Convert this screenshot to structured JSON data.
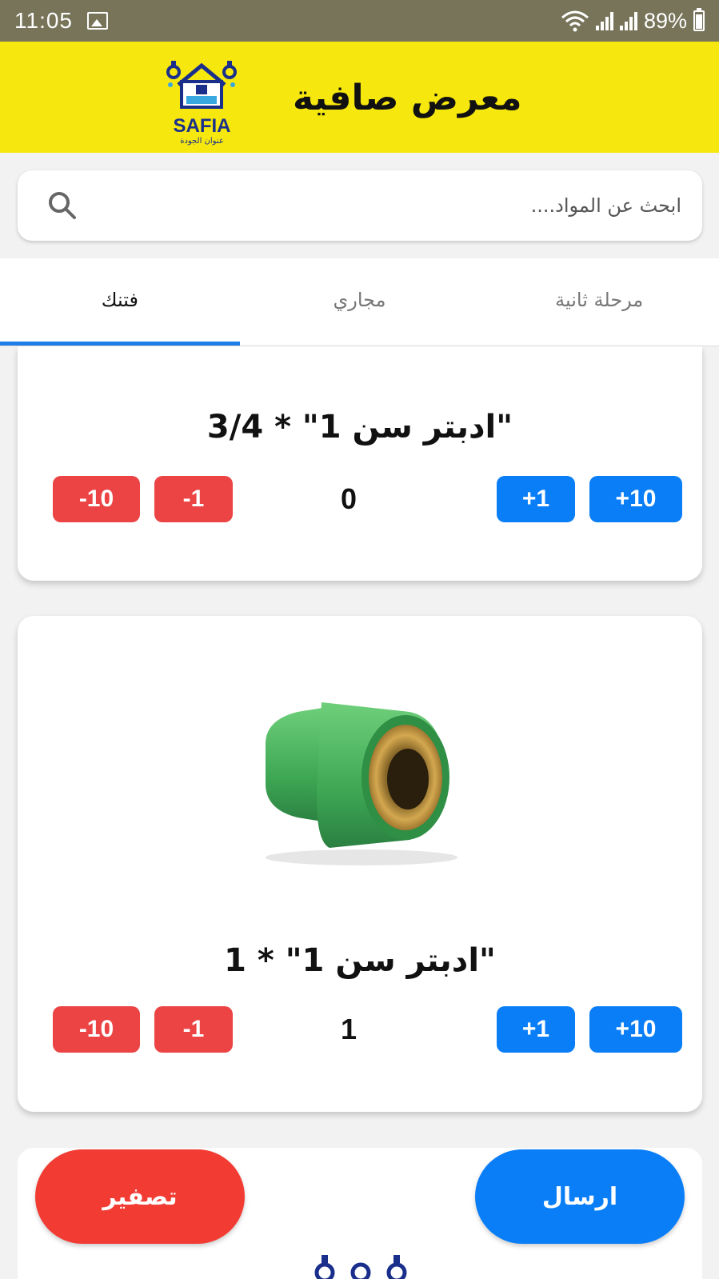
{
  "status_bar": {
    "time": "11:05",
    "battery": "89%",
    "icons": [
      "gallery-icon",
      "wifi-icon",
      "signal-icon",
      "signal-icon",
      "battery-icon"
    ]
  },
  "header": {
    "title": "معرض صافية",
    "logo_text": "SAFIA",
    "logo_subtitle": "عنوان الجودة"
  },
  "search": {
    "placeholder": "ابحث عن المواد....",
    "icon": "search-icon"
  },
  "tabs": [
    {
      "label": "مرحلة ثانية",
      "active": false
    },
    {
      "label": "مجاري",
      "active": false
    },
    {
      "label": "فتنك",
      "active": true
    }
  ],
  "products": [
    {
      "name": "ادبتر سن 1\" * 3/4\"",
      "quantity": "0",
      "buttons": {
        "plus10": "+10",
        "plus1": "+1",
        "minus1": "-1",
        "minus10": "-10"
      }
    },
    {
      "name": "ادبتر سن 1\" * 1\"",
      "quantity": "1",
      "image": "green-ppr-threaded-adapter",
      "buttons": {
        "plus10": "+10",
        "plus1": "+1",
        "minus1": "-1",
        "minus10": "-10"
      }
    }
  ],
  "actions": {
    "send_label": "ارسال",
    "reset_label": "تصفير"
  },
  "colors": {
    "status_bar": "#77745a",
    "header_bg": "#f6e70e",
    "accent_blue": "#0a7ef7",
    "danger_red": "#ec4444",
    "reset_red": "#f23c33",
    "logo_blue": "#1a2f8c"
  }
}
